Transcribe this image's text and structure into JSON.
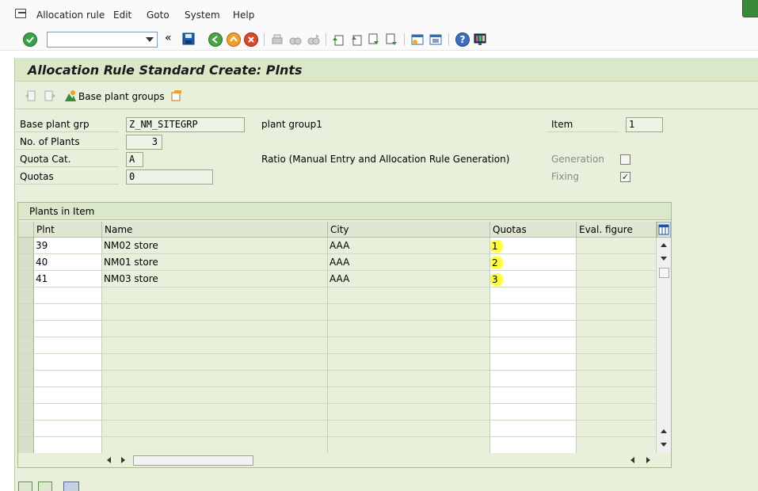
{
  "menu": {
    "items": [
      "Allocation rule",
      "Edit",
      "Goto",
      "System",
      "Help"
    ]
  },
  "toolbar": {
    "command_value": "",
    "icons": [
      "enter-icon",
      "save-icon",
      "back-icon",
      "exit-icon",
      "cancel-icon",
      "print-icon",
      "find-icon",
      "find-next-icon",
      "first-page-icon",
      "previous-page-icon",
      "next-page-icon",
      "last-page-icon",
      "create-session-icon",
      "shortcut-icon",
      "help-icon",
      "customize-layout-icon"
    ]
  },
  "screen": {
    "title": "Allocation Rule Standard Create: Plnts",
    "base_plant_groups_label": "Base plant groups"
  },
  "header": {
    "base_plant_grp_label": "Base plant grp",
    "base_plant_grp_value": "Z_NM_SITEGRP",
    "base_plant_grp_desc": "plant group1",
    "no_of_plants_label": "No. of Plants",
    "no_of_plants_value": "3",
    "quota_cat_label": "Quota Cat.",
    "quota_cat_value": "A",
    "quota_cat_desc": "Ratio (Manual Entry and Allocation Rule Generation)",
    "quotas_label": "Quotas",
    "quotas_value": "0",
    "item_label": "Item",
    "item_value": "1",
    "generation_label": "Generation",
    "generation_checked": false,
    "fixing_label": "Fixing",
    "fixing_checked": true
  },
  "table": {
    "caption": "Plants in Item",
    "columns": [
      "Plnt",
      "Name",
      "City",
      "Quotas",
      "Eval. figure"
    ],
    "rows": [
      [
        "39",
        "NM02 store",
        "AAA",
        "1",
        ""
      ],
      [
        "40",
        "NM01 store",
        "AAA",
        "2",
        ""
      ],
      [
        "41",
        "NM03 store",
        "AAA",
        "3",
        ""
      ]
    ],
    "empty_rows": 10
  },
  "colors": {
    "panel_bg": "#e8f0dc",
    "highlight": "#ffff44"
  }
}
